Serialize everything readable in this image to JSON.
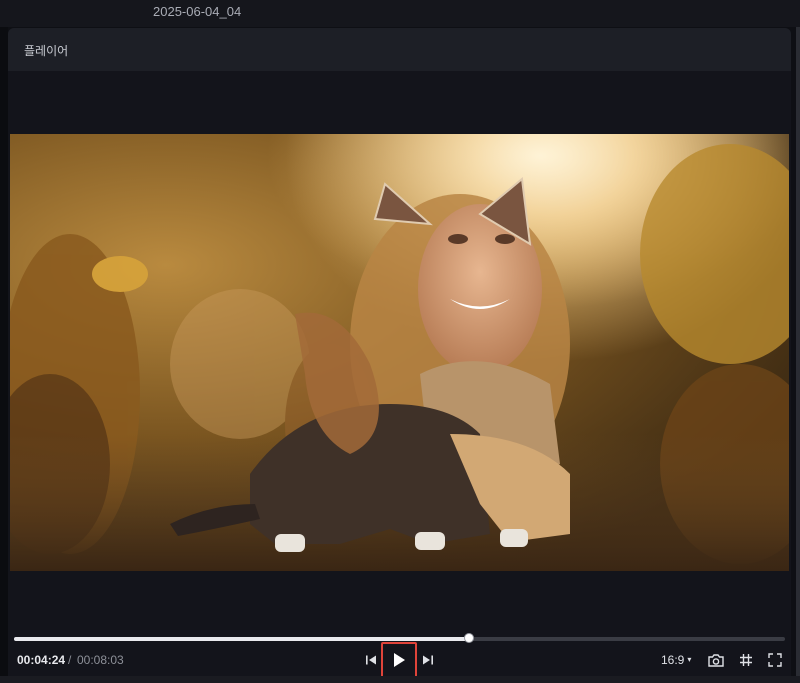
{
  "window": {
    "project_title": "2025-06-04_04"
  },
  "player": {
    "panel_title": "플레이어",
    "current_time": "00:04:24",
    "separator": "/",
    "total_time": "00:08:03",
    "progress_fraction": 0.59,
    "aspect_ratio": "16:9",
    "caret": "▾"
  },
  "icons": {
    "prev_frame": "previous-frame-icon",
    "play": "play-icon",
    "next_frame": "next-frame-icon",
    "snapshot": "camera-icon",
    "grid": "grid-icon",
    "fullscreen": "fullscreen-icon"
  },
  "colors": {
    "accent_highlight": "#e0443a",
    "progress_fill": "#e9eaee",
    "panel_bg": "#13141b"
  }
}
